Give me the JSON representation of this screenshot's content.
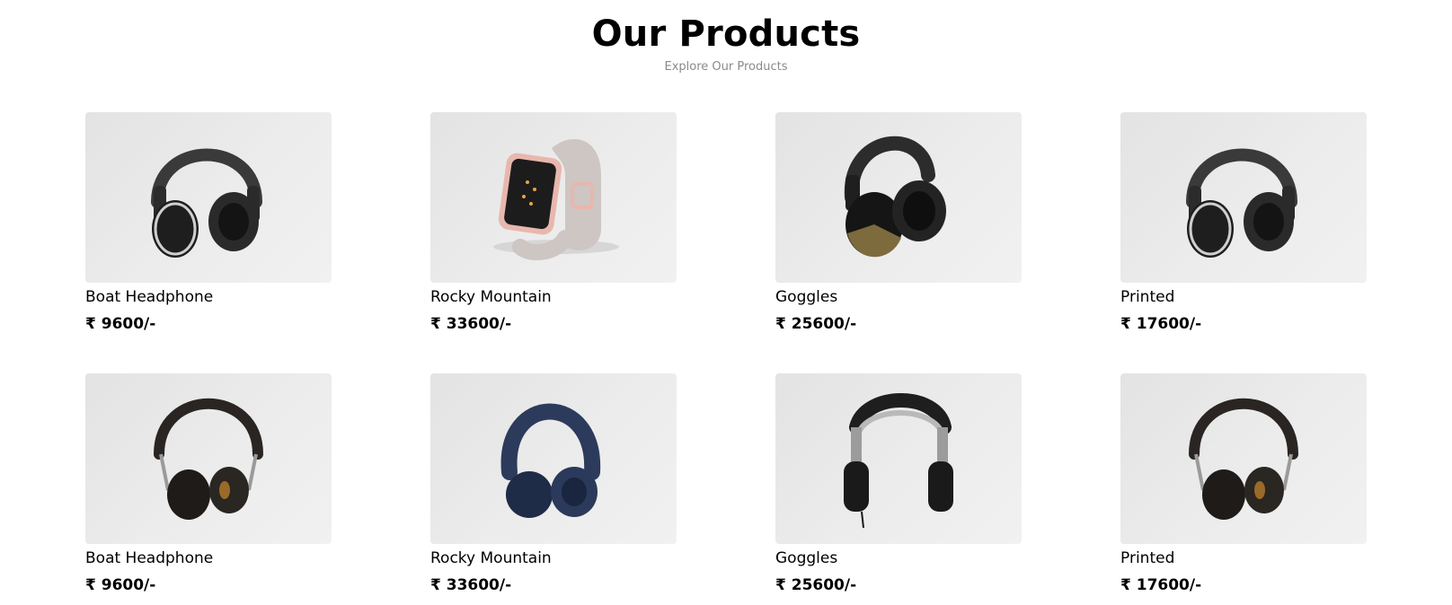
{
  "header": {
    "title": "Our Products",
    "subtitle": "Explore Our Products"
  },
  "products": [
    {
      "name": "Boat Headphone",
      "price": "₹ 9600/-",
      "icon": "black-headphone-icon"
    },
    {
      "name": "Rocky Mountain",
      "price": "₹ 33600/-",
      "icon": "smartwatch-icon"
    },
    {
      "name": "Goggles",
      "price": "₹ 25600/-",
      "icon": "dj-headphone-icon"
    },
    {
      "name": "Printed",
      "price": "₹ 17600/-",
      "icon": "black-headphone-icon"
    },
    {
      "name": "Boat Headphone",
      "price": "₹ 9600/-",
      "icon": "leather-headphone-icon"
    },
    {
      "name": "Rocky Mountain",
      "price": "₹ 33600/-",
      "icon": "blue-headphone-icon"
    },
    {
      "name": "Goggles",
      "price": "₹ 25600/-",
      "icon": "silver-headphone-icon"
    },
    {
      "name": "Printed",
      "price": "₹ 17600/-",
      "icon": "leather-headphone-icon"
    }
  ],
  "colors": {
    "card_background": "#e8e8e8",
    "subtitle": "#8a8a8a"
  }
}
